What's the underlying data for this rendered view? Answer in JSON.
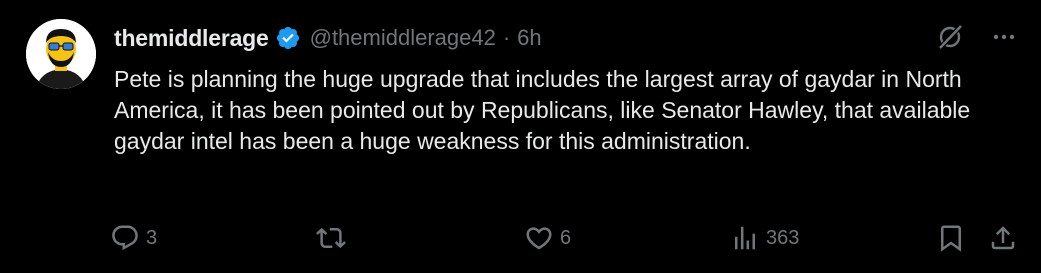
{
  "tweet": {
    "display_name": "themiddlerage",
    "handle": "@themiddlerage42",
    "separator": "·",
    "timestamp": "6h",
    "text": "Pete is planning the huge upgrade that includes the largest array of gaydar in North America, it has been pointed out by Republicans, like Senator Hawley, that available gaydar intel has been a huge weakness for this administration.",
    "verified": true
  },
  "actions": {
    "replies": "3",
    "reposts": "",
    "likes": "6",
    "views": "363"
  },
  "icons": {
    "verified": "verified-badge-icon",
    "grok": "grok-icon",
    "more": "more-icon",
    "reply": "reply-icon",
    "repost": "repost-icon",
    "like": "heart-icon",
    "views": "views-icon",
    "bookmark": "bookmark-icon",
    "share": "share-icon"
  },
  "colors": {
    "background": "#000000",
    "primary_text": "#e7e9ea",
    "secondary_text": "#71767b",
    "verified_blue": "#1d9bf0",
    "avatar_yellow": "#f5c218"
  }
}
